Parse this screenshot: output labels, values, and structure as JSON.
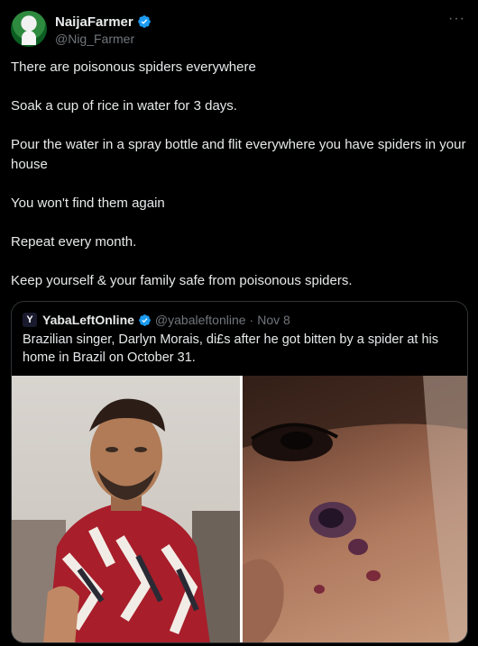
{
  "author": {
    "display_name": "NaijaFarmer",
    "handle": "@Nig_Farmer"
  },
  "more_icon": "more-horizontal-icon",
  "tweet": {
    "paragraphs": [
      "There are poisonous spiders everywhere",
      "Soak a cup of rice in water for 3 days.",
      "Pour the water in a spray bottle and flit everywhere you have spiders in your house",
      "You won't find them again",
      "Repeat every month.",
      "Keep yourself & your family safe from poisonous spiders."
    ]
  },
  "quoted_tweet": {
    "avatar_letter": "Y",
    "display_name": "YabaLeftOnline",
    "handle": "@yabaleftonline",
    "separator": "·",
    "date": "Nov 8",
    "text": "Brazilian singer, Darlyn Morais, di£s after he got bitten by a spider at his home in Brazil on October 31."
  },
  "colors": {
    "background": "#000000",
    "text": "#e7e9ea",
    "secondary_text": "#71767b",
    "verified_blue": "#1d9bf0",
    "border": "#2f3336"
  }
}
